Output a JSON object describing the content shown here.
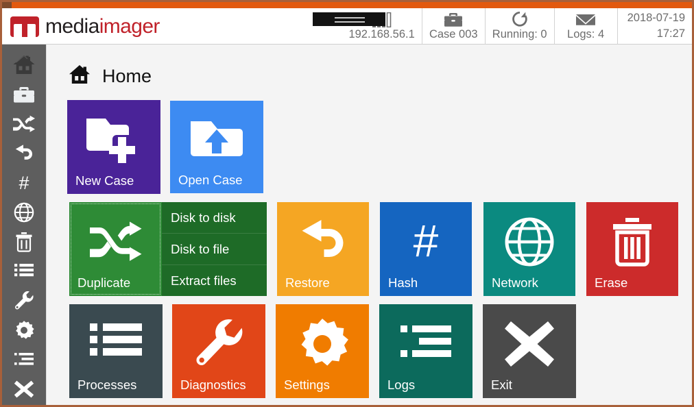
{
  "app": {
    "logo_word1": "media",
    "logo_word2": "imager",
    "accent_orange": "#e2590f",
    "border_color": "#a8603a"
  },
  "status": {
    "items": [
      {
        "icon": "signal-bars-icon",
        "label": "192.168.56.1"
      },
      {
        "icon": "briefcase-icon",
        "label": "Case 003"
      },
      {
        "icon": "rotate-icon",
        "label": "Running: 0"
      },
      {
        "icon": "envelope-icon",
        "label": "Logs: 4"
      }
    ],
    "date": "2018-07-19",
    "time": "17:27"
  },
  "sidebar": {
    "items": [
      {
        "name": "home",
        "icon": "home-icon",
        "active": true
      },
      {
        "name": "cases",
        "icon": "briefcase-icon",
        "active": false
      },
      {
        "name": "duplicate",
        "icon": "shuffle-icon",
        "active": false
      },
      {
        "name": "restore",
        "icon": "undo-icon",
        "active": false
      },
      {
        "name": "hash",
        "icon": "hash-icon",
        "active": false
      },
      {
        "name": "network",
        "icon": "globe-icon",
        "active": false
      },
      {
        "name": "erase",
        "icon": "trash-icon",
        "active": false
      },
      {
        "name": "processes",
        "icon": "list-icon",
        "active": false
      },
      {
        "name": "diagnostics",
        "icon": "wrench-icon",
        "active": false
      },
      {
        "name": "settings",
        "icon": "gear-icon",
        "active": false
      },
      {
        "name": "logs",
        "icon": "logs-icon",
        "active": false
      },
      {
        "name": "exit",
        "icon": "close-icon",
        "active": false
      }
    ]
  },
  "page": {
    "title": "Home",
    "title_icon": "home-icon"
  },
  "tiles": {
    "new_case": {
      "label": "New Case",
      "icon": "folder-plus-icon",
      "color": "#4a2398"
    },
    "open_case": {
      "label": "Open Case",
      "icon": "folder-upload-icon",
      "color": "#3d8bf2"
    },
    "duplicate": {
      "label": "Duplicate",
      "icon": "shuffle-icon",
      "color": "#2e8b36",
      "submenu_color": "#1e6b27",
      "submenu": [
        "Disk to disk",
        "Disk to file",
        "Extract files"
      ]
    },
    "restore": {
      "label": "Restore",
      "icon": "undo-icon",
      "color": "#f5a623"
    },
    "hash": {
      "label": "Hash",
      "icon": "hash-icon",
      "color": "#1565c0"
    },
    "network": {
      "label": "Network",
      "icon": "globe-icon",
      "color": "#0b8a80"
    },
    "erase": {
      "label": "Erase",
      "icon": "trash-icon",
      "color": "#cc2b2b"
    },
    "processes": {
      "label": "Processes",
      "icon": "list-icon",
      "color": "#3a4a50"
    },
    "diagnostics": {
      "label": "Diagnostics",
      "icon": "wrench-icon",
      "color": "#e14618"
    },
    "settings": {
      "label": "Settings",
      "icon": "gear-icon",
      "color": "#f07c00"
    },
    "logs": {
      "label": "Logs",
      "icon": "logs-icon",
      "color": "#0c6a5c"
    },
    "exit": {
      "label": "Exit",
      "icon": "close-icon",
      "color": "#4a4a4a"
    }
  }
}
